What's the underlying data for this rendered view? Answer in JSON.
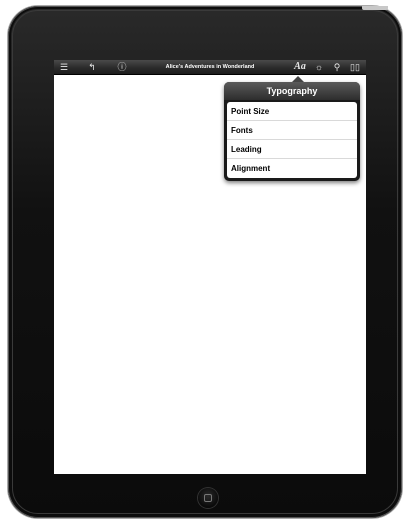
{
  "app": {
    "title": "Alice's Adventures in Wonderland"
  },
  "toolbar": {
    "icons": {
      "library": "list-icon",
      "back": "back-arrow-icon",
      "info": "info-icon",
      "typography": "Aa",
      "brightness": "brightness-icon",
      "search": "search-icon",
      "bookmarks": "book-icon"
    }
  },
  "typography_menu": {
    "title": "Typography",
    "items": [
      {
        "label": "Point Size"
      },
      {
        "label": "Fonts"
      },
      {
        "label": "Leading"
      },
      {
        "label": "Alignment"
      }
    ]
  },
  "colors": {
    "toolbar": "#2b2b2b",
    "bezel": "#111111",
    "popover": "#1a1a1a",
    "screen": "#ffffff"
  }
}
